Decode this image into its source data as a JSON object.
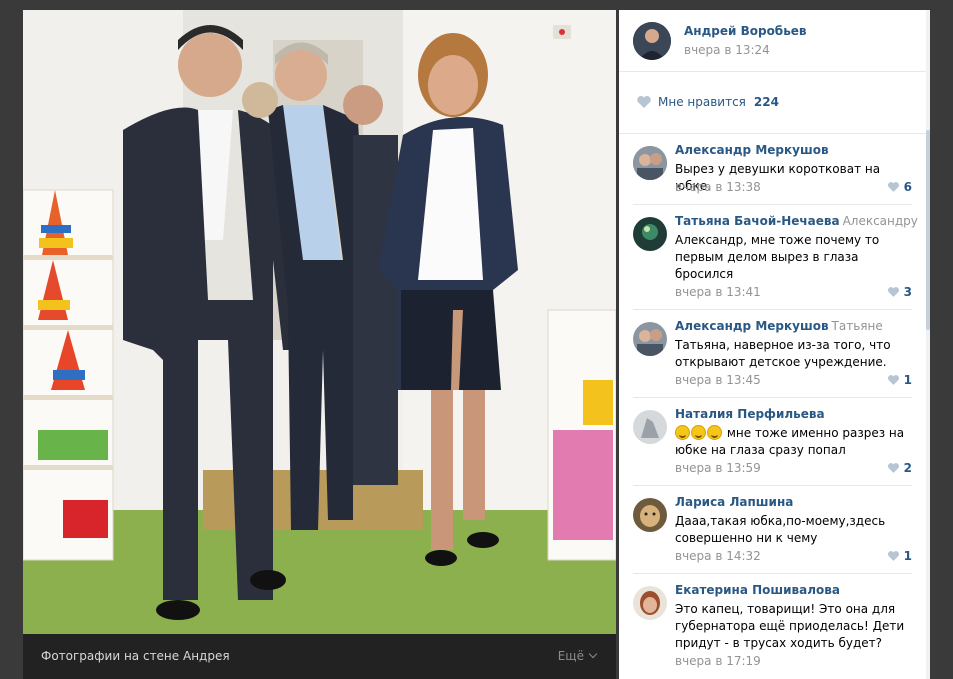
{
  "photo": {
    "caption": "Фотографии на стене Андрея",
    "more_label": "Ещё"
  },
  "post": {
    "author_name": "Андрей Воробьев",
    "time": "вчера в 13:24",
    "like_label": "Мне нравится",
    "like_count": "224"
  },
  "comments": [
    {
      "author": "Александр Меркушов",
      "reply_to": "",
      "text": "Вырез у девушки коротковат на юбке.",
      "time": "вчера в 13:38",
      "likes": "6",
      "avatar_color": "#6b7a86"
    },
    {
      "author": "Татьяна Бачой-Нечаева",
      "reply_to": "Александру",
      "text": "Александр, мне тоже почему то первым делом вырез в глаза бросился",
      "time": "вчера в 13:41",
      "likes": "3",
      "avatar_color": "#2f6b4a"
    },
    {
      "author": "Александр Меркушов",
      "reply_to": "Татьяне",
      "text": "Татьяна, наверное из-за того, что открывают детское учреждение.",
      "time": "вчера в 13:45",
      "likes": "1",
      "avatar_color": "#6b7a86"
    },
    {
      "author": "Наталия Перфильева",
      "reply_to": "",
      "text": "мне тоже именно разрез на юбке на глаза сразу попал",
      "emoji_count": 3,
      "time": "вчера в 13:59",
      "likes": "2",
      "avatar_color": "#b9bec4"
    },
    {
      "author": "Лариса Лапшина",
      "reply_to": "",
      "text": "Дааа,такая юбка,по-моему,здесь совершенно ни к чему",
      "time": "вчера в 14:32",
      "likes": "1",
      "avatar_color": "#c9a66b"
    },
    {
      "author": "Екатерина Пошивалова",
      "reply_to": "",
      "text": "Это капец, товарищи! Это она для губернатора ещё приоделась! Дети придут - в трусах ходить будет?",
      "time": "вчера в 17:19",
      "likes": "",
      "avatar_color": "#b5714f"
    }
  ],
  "colors": {
    "link": "#2a5885",
    "muted": "#939393",
    "heart": "#b7c4d3"
  }
}
